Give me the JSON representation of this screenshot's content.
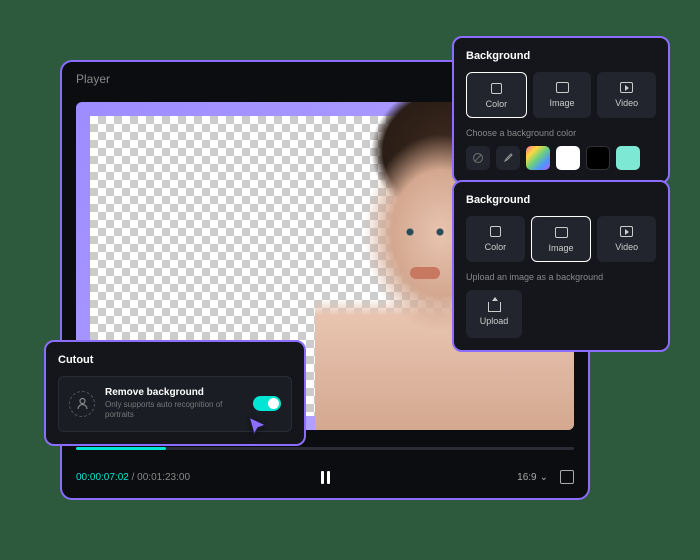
{
  "player": {
    "title": "Player",
    "current_time": "00:00:07:02",
    "total_time": "00:01:23:00",
    "aspect_ratio": "16:9"
  },
  "cutout": {
    "panel_title": "Cutout",
    "feature_title": "Remove background",
    "feature_subtitle": "Only supports auto recognition of portraits",
    "toggle_on": true
  },
  "bg_panel_color": {
    "title": "Background",
    "tabs": {
      "color": "Color",
      "image": "Image",
      "video": "Video"
    },
    "active_tab": "color",
    "hint": "Choose a background color",
    "swatches": [
      "none",
      "eyedropper",
      "rainbow",
      "white",
      "black",
      "mint"
    ]
  },
  "bg_panel_image": {
    "title": "Background",
    "tabs": {
      "color": "Color",
      "image": "Image",
      "video": "Video"
    },
    "active_tab": "image",
    "hint": "Upload an image as a background",
    "upload_label": "Upload"
  }
}
